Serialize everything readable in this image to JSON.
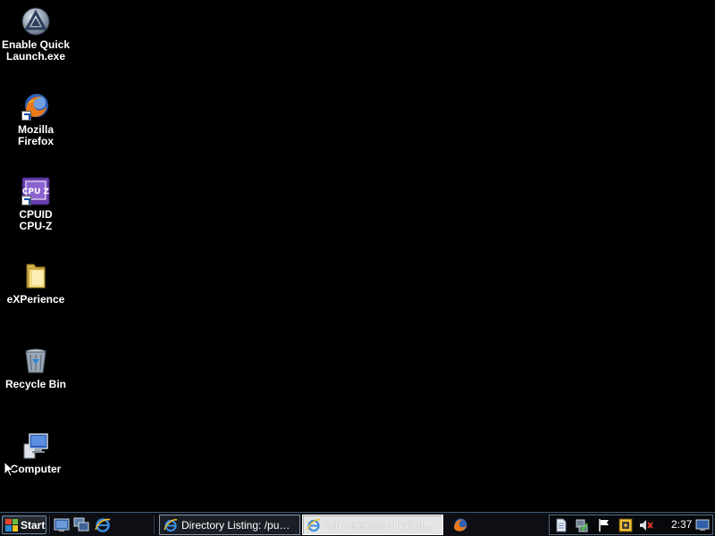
{
  "desktop": {
    "icons": [
      {
        "label": "Enable Quick\nLaunch.exe",
        "icon": "app-triangle-icon"
      },
      {
        "label": "Mozilla\nFirefox",
        "icon": "firefox-icon"
      },
      {
        "label": "CPUID\nCPU-Z",
        "icon": "cpuz-icon"
      },
      {
        "label": "eXPerience",
        "icon": "folder-icon"
      },
      {
        "label": "Recycle Bin",
        "icon": "recycle-bin-icon"
      },
      {
        "label": "Computer",
        "icon": "computer-icon"
      }
    ]
  },
  "taskbar": {
    "start_label": "Start",
    "quick_launch": [
      "show-desktop-icon",
      "window-switcher-icon",
      "internet-explorer-icon"
    ],
    "tasks": [
      {
        "label": "Directory Listing: /pub/fire...",
        "icon": "internet-explorer-icon",
        "active": false
      },
      {
        "label": "Old versions of Wind...",
        "icon": "internet-explorer-icon",
        "active": true
      }
    ],
    "pinned_app_icon": "firefox-icon",
    "tray_icons": [
      "document-icon",
      "network-check-icon",
      "flag-icon",
      "security-icon",
      "volume-muted-icon"
    ],
    "clock": "2:37"
  }
}
